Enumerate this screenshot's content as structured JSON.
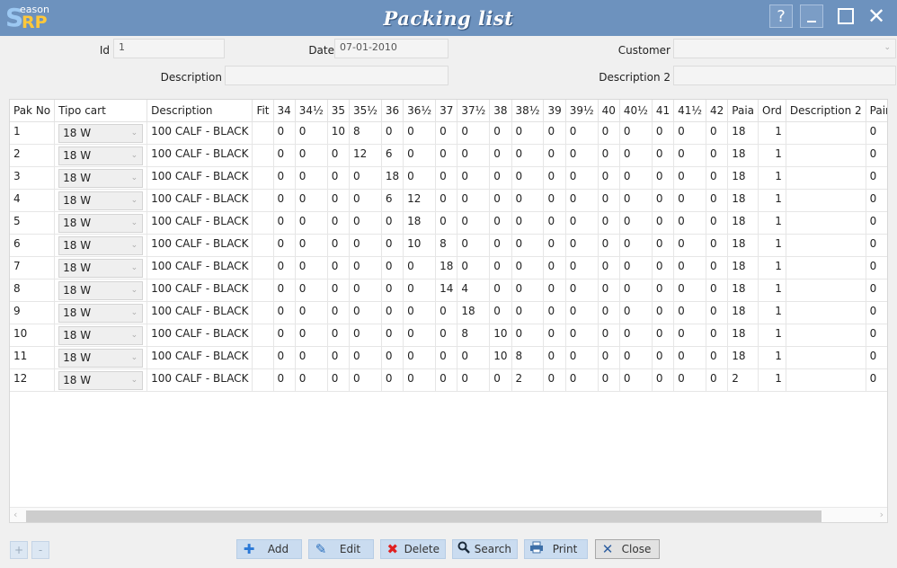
{
  "app": {
    "logo_s": "S",
    "logo_eason": "eason",
    "logo_rp": "RP",
    "title": "Packing list"
  },
  "window_controls": {
    "help": "?"
  },
  "form": {
    "id_label": "Id",
    "id_value": "1",
    "date_label": "Date",
    "date_value": "07-01-2010",
    "customer_label": "Customer",
    "customer_value": "",
    "description_label": "Description",
    "description_value": "",
    "description2_label": "Description 2",
    "description2_value": ""
  },
  "grid": {
    "columns": [
      "Pak No",
      "Tipo cart",
      "Description",
      "Fit",
      "34",
      "34½",
      "35",
      "35½",
      "36",
      "36½",
      "37",
      "37½",
      "38",
      "38½",
      "39",
      "39½",
      "40",
      "40½",
      "41",
      "41½",
      "42",
      "Paia",
      "Ord",
      "Description 2",
      "Pair wei"
    ],
    "rows": [
      {
        "pak": "1",
        "tipo": "18 W",
        "desc": "100 CALF - BLACK",
        "fit": "",
        "sizes": [
          "0",
          "0",
          "10",
          "8",
          "0",
          "0",
          "0",
          "0",
          "0",
          "0",
          "0",
          "0",
          "0",
          "0",
          "0",
          "0",
          "0"
        ],
        "paia": "18",
        "ord": "1",
        "desc2": "",
        "weight": "0"
      },
      {
        "pak": "2",
        "tipo": "18 W",
        "desc": "100 CALF - BLACK",
        "fit": "",
        "sizes": [
          "0",
          "0",
          "0",
          "12",
          "6",
          "0",
          "0",
          "0",
          "0",
          "0",
          "0",
          "0",
          "0",
          "0",
          "0",
          "0",
          "0"
        ],
        "paia": "18",
        "ord": "1",
        "desc2": "",
        "weight": "0"
      },
      {
        "pak": "3",
        "tipo": "18 W",
        "desc": "100 CALF - BLACK",
        "fit": "",
        "sizes": [
          "0",
          "0",
          "0",
          "0",
          "18",
          "0",
          "0",
          "0",
          "0",
          "0",
          "0",
          "0",
          "0",
          "0",
          "0",
          "0",
          "0"
        ],
        "paia": "18",
        "ord": "1",
        "desc2": "",
        "weight": "0"
      },
      {
        "pak": "4",
        "tipo": "18 W",
        "desc": "100 CALF - BLACK",
        "fit": "",
        "sizes": [
          "0",
          "0",
          "0",
          "0",
          "6",
          "12",
          "0",
          "0",
          "0",
          "0",
          "0",
          "0",
          "0",
          "0",
          "0",
          "0",
          "0"
        ],
        "paia": "18",
        "ord": "1",
        "desc2": "",
        "weight": "0"
      },
      {
        "pak": "5",
        "tipo": "18 W",
        "desc": "100 CALF - BLACK",
        "fit": "",
        "sizes": [
          "0",
          "0",
          "0",
          "0",
          "0",
          "18",
          "0",
          "0",
          "0",
          "0",
          "0",
          "0",
          "0",
          "0",
          "0",
          "0",
          "0"
        ],
        "paia": "18",
        "ord": "1",
        "desc2": "",
        "weight": "0"
      },
      {
        "pak": "6",
        "tipo": "18 W",
        "desc": "100 CALF - BLACK",
        "fit": "",
        "sizes": [
          "0",
          "0",
          "0",
          "0",
          "0",
          "10",
          "8",
          "0",
          "0",
          "0",
          "0",
          "0",
          "0",
          "0",
          "0",
          "0",
          "0"
        ],
        "paia": "18",
        "ord": "1",
        "desc2": "",
        "weight": "0"
      },
      {
        "pak": "7",
        "tipo": "18 W",
        "desc": "100 CALF - BLACK",
        "fit": "",
        "sizes": [
          "0",
          "0",
          "0",
          "0",
          "0",
          "0",
          "18",
          "0",
          "0",
          "0",
          "0",
          "0",
          "0",
          "0",
          "0",
          "0",
          "0"
        ],
        "paia": "18",
        "ord": "1",
        "desc2": "",
        "weight": "0"
      },
      {
        "pak": "8",
        "tipo": "18 W",
        "desc": "100 CALF - BLACK",
        "fit": "",
        "sizes": [
          "0",
          "0",
          "0",
          "0",
          "0",
          "0",
          "14",
          "4",
          "0",
          "0",
          "0",
          "0",
          "0",
          "0",
          "0",
          "0",
          "0"
        ],
        "paia": "18",
        "ord": "1",
        "desc2": "",
        "weight": "0"
      },
      {
        "pak": "9",
        "tipo": "18 W",
        "desc": "100 CALF - BLACK",
        "fit": "",
        "sizes": [
          "0",
          "0",
          "0",
          "0",
          "0",
          "0",
          "0",
          "18",
          "0",
          "0",
          "0",
          "0",
          "0",
          "0",
          "0",
          "0",
          "0"
        ],
        "paia": "18",
        "ord": "1",
        "desc2": "",
        "weight": "0"
      },
      {
        "pak": "10",
        "tipo": "18 W",
        "desc": "100 CALF - BLACK",
        "fit": "",
        "sizes": [
          "0",
          "0",
          "0",
          "0",
          "0",
          "0",
          "0",
          "8",
          "10",
          "0",
          "0",
          "0",
          "0",
          "0",
          "0",
          "0",
          "0"
        ],
        "paia": "18",
        "ord": "1",
        "desc2": "",
        "weight": "0"
      },
      {
        "pak": "11",
        "tipo": "18 W",
        "desc": "100 CALF - BLACK",
        "fit": "",
        "sizes": [
          "0",
          "0",
          "0",
          "0",
          "0",
          "0",
          "0",
          "0",
          "10",
          "8",
          "0",
          "0",
          "0",
          "0",
          "0",
          "0",
          "0"
        ],
        "paia": "18",
        "ord": "1",
        "desc2": "",
        "weight": "0"
      },
      {
        "pak": "12",
        "tipo": "18 W",
        "desc": "100 CALF - BLACK",
        "fit": "",
        "sizes": [
          "0",
          "0",
          "0",
          "0",
          "0",
          "0",
          "0",
          "0",
          "0",
          "2",
          "0",
          "0",
          "0",
          "0",
          "0",
          "0",
          "0"
        ],
        "paia": "2",
        "ord": "1",
        "desc2": "",
        "weight": "0"
      }
    ]
  },
  "bottom": {
    "plus": "+",
    "minus": "-",
    "add": "Add",
    "edit": "Edit",
    "delete": "Delete",
    "search": "Search",
    "print": "Print",
    "close": "Close"
  },
  "colors": {
    "titlebar": "#6d92be",
    "button_bg": "#cadcf0",
    "add_icon": "#2a78d6",
    "delete_icon": "#e02020"
  },
  "icons": {
    "add": "plus-icon",
    "edit": "pencil-icon",
    "delete": "x-icon",
    "search": "magnifier-icon",
    "print": "printer-icon",
    "close": "x-icon"
  }
}
